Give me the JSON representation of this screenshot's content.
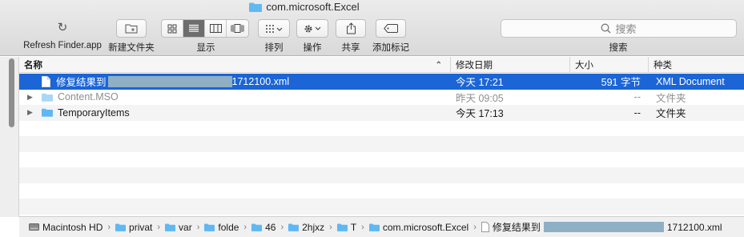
{
  "window": {
    "title": "com.microsoft.Excel"
  },
  "toolbar": {
    "refresh_label": "Refresh Finder.app",
    "new_folder_label": "新建文件夹",
    "view_label": "显示",
    "arrange_label": "排列",
    "action_label": "操作",
    "share_label": "共享",
    "tags_label": "添加标记",
    "search_label": "搜索",
    "search_placeholder": "搜索",
    "active_view": "list"
  },
  "columns": {
    "name": "名称",
    "date": "修改日期",
    "size": "大小",
    "kind": "种类"
  },
  "files": [
    {
      "name_prefix": "修复结果到",
      "name_suffix": "1712100.xml",
      "date": "今天 17:21",
      "size": "591 字节",
      "kind": "XML Document",
      "type": "file",
      "selected": true,
      "dimmed": false
    },
    {
      "name_prefix": "Content.MSO",
      "name_suffix": "",
      "date": "昨天 09:05",
      "size": "--",
      "kind": "文件夹",
      "type": "folder",
      "selected": false,
      "dimmed": true
    },
    {
      "name_prefix": "TemporaryItems",
      "name_suffix": "",
      "date": "今天 17:13",
      "size": "--",
      "kind": "文件夹",
      "type": "folder",
      "selected": false,
      "dimmed": false
    }
  ],
  "path": {
    "disk": "Macintosh HD",
    "p1": "privat",
    "p2": "var",
    "p3": "folde",
    "p4": "46",
    "p5": "2hjxz",
    "p6": "T",
    "p7": "com.microsoft.Excel",
    "file_prefix": "修复结果到",
    "file_suffix": "1712100.xml"
  },
  "colors": {
    "selection": "#1b65d6",
    "folder": "#5fb8f3"
  }
}
